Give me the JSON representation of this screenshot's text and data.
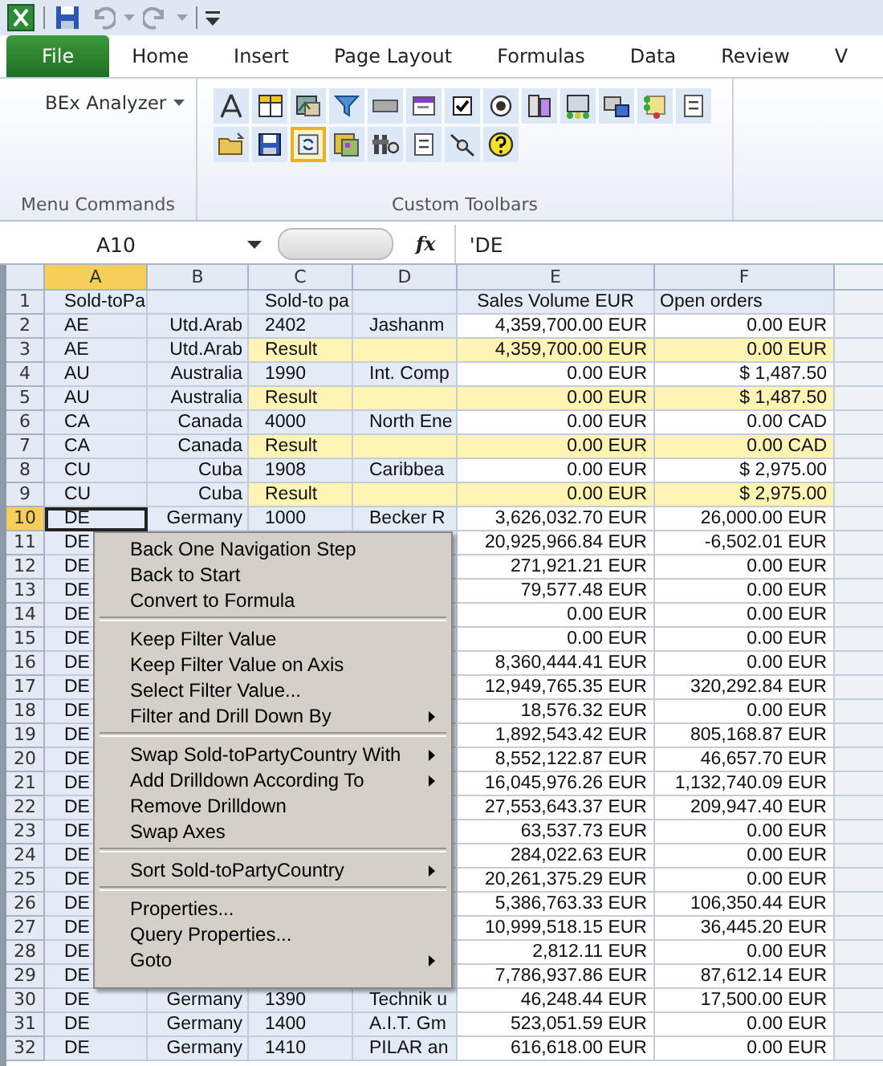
{
  "ribbon_tabs": [
    {
      "label": "File",
      "kind": "file"
    },
    {
      "label": "Home",
      "kind": "tab"
    },
    {
      "label": "Insert",
      "kind": "tab"
    },
    {
      "label": "Page Layout",
      "kind": "tab"
    },
    {
      "label": "Formulas",
      "kind": "tab"
    },
    {
      "label": "Data",
      "kind": "tab"
    },
    {
      "label": "Review",
      "kind": "tab"
    },
    {
      "label": "V",
      "kind": "tab"
    }
  ],
  "ribbon": {
    "menu_commands": {
      "button": "BEx Analyzer",
      "label": "Menu Commands"
    },
    "custom_toolbars": {
      "label": "Custom Toolbars",
      "buttons": [
        {
          "selected": false
        },
        {
          "selected": false
        },
        {
          "selected": false
        },
        {
          "selected": false
        },
        {
          "selected": false
        },
        {
          "selected": false
        },
        {
          "selected": false
        },
        {
          "selected": false
        },
        {
          "selected": false
        },
        {
          "selected": false
        },
        {
          "selected": false
        },
        {
          "selected": false
        },
        {
          "selected": false
        },
        {
          "selected": false
        },
        {
          "selected": false
        },
        {
          "selected": true
        },
        {
          "selected": false
        },
        {
          "selected": false
        },
        {
          "selected": false
        },
        {
          "selected": false
        },
        {
          "selected": false
        }
      ]
    }
  },
  "formula_bar": {
    "name_box": "A10",
    "fx": "fx",
    "value": "'DE"
  },
  "columns": [
    {
      "label": "A",
      "selected": true
    },
    {
      "label": "B",
      "selected": false
    },
    {
      "label": "C",
      "selected": false
    },
    {
      "label": "D",
      "selected": false
    },
    {
      "label": "E",
      "selected": false
    },
    {
      "label": "F",
      "selected": false
    }
  ],
  "rows": [
    {
      "num": "1",
      "kind": "header",
      "selected": false,
      "a": "Sold-toPa",
      "c": "Sold-to pa",
      "e": "Sales Volume EUR",
      "f": "Open orders"
    },
    {
      "num": "2",
      "kind": "data",
      "selected": false,
      "a": "AE",
      "b": "Utd.Arab",
      "c": "2402",
      "d": "Jashanm",
      "e": "4,359,700.00 EUR",
      "f": "0.00 EUR"
    },
    {
      "num": "3",
      "kind": "result",
      "selected": false,
      "a": "AE",
      "b": "Utd.Arab",
      "c": "Result",
      "e": "4,359,700.00 EUR",
      "f": "0.00 EUR"
    },
    {
      "num": "4",
      "kind": "data",
      "selected": false,
      "a": "AU",
      "b": "Australia",
      "c": "1990",
      "d": "Int. Comp",
      "e": "0.00 EUR",
      "f": "$ 1,487.50"
    },
    {
      "num": "5",
      "kind": "result",
      "selected": false,
      "a": "AU",
      "b": "Australia",
      "c": "Result",
      "e": "0.00 EUR",
      "f": "$ 1,487.50"
    },
    {
      "num": "6",
      "kind": "data",
      "selected": false,
      "a": "CA",
      "b": "Canada",
      "c": "4000",
      "d": "North Ene",
      "e": "0.00 EUR",
      "f": "0.00 CAD"
    },
    {
      "num": "7",
      "kind": "result",
      "selected": false,
      "a": "CA",
      "b": "Canada",
      "c": "Result",
      "e": "0.00 EUR",
      "f": "0.00 CAD"
    },
    {
      "num": "8",
      "kind": "data",
      "selected": false,
      "a": "CU",
      "b": "Cuba",
      "c": "1908",
      "d": "Caribbea",
      "e": "0.00 EUR",
      "f": "$ 2,975.00"
    },
    {
      "num": "9",
      "kind": "result",
      "selected": false,
      "a": "CU",
      "b": "Cuba",
      "c": "Result",
      "e": "0.00 EUR",
      "f": "$ 2,975.00"
    },
    {
      "num": "10",
      "kind": "data",
      "selected": true,
      "a": "DE",
      "b": "Germany",
      "c": "1000",
      "d": "Becker R",
      "e": "3,626,032.70 EUR",
      "f": "26,000.00 EUR"
    },
    {
      "num": "11",
      "kind": "data",
      "selected": false,
      "a": "DE",
      "e": "20,925,966.84 EUR",
      "f": "-6,502.01 EUR"
    },
    {
      "num": "12",
      "kind": "data",
      "selected": false,
      "a": "DE",
      "e": "271,921.21 EUR",
      "f": "0.00 EUR"
    },
    {
      "num": "13",
      "kind": "data",
      "selected": false,
      "a": "DE",
      "e": "79,577.48 EUR",
      "f": "0.00 EUR"
    },
    {
      "num": "14",
      "kind": "data",
      "selected": false,
      "a": "DE",
      "e": "0.00 EUR",
      "f": "0.00 EUR"
    },
    {
      "num": "15",
      "kind": "data",
      "selected": false,
      "a": "DE",
      "e": "0.00 EUR",
      "f": "0.00 EUR"
    },
    {
      "num": "16",
      "kind": "data",
      "selected": false,
      "a": "DE",
      "e": "8,360,444.41 EUR",
      "f": "0.00 EUR"
    },
    {
      "num": "17",
      "kind": "data",
      "selected": false,
      "a": "DE",
      "e": "12,949,765.35 EUR",
      "f": "320,292.84 EUR"
    },
    {
      "num": "18",
      "kind": "data",
      "selected": false,
      "a": "DE",
      "e": "18,576.32 EUR",
      "f": "0.00 EUR"
    },
    {
      "num": "19",
      "kind": "data",
      "selected": false,
      "a": "DE",
      "e": "1,892,543.42 EUR",
      "f": "805,168.87 EUR"
    },
    {
      "num": "20",
      "kind": "data",
      "selected": false,
      "a": "DE",
      "e": "8,552,122.87 EUR",
      "f": "46,657.70 EUR"
    },
    {
      "num": "21",
      "kind": "data",
      "selected": false,
      "a": "DE",
      "e": "16,045,976.26 EUR",
      "f": "1,132,740.09 EUR"
    },
    {
      "num": "22",
      "kind": "data",
      "selected": false,
      "a": "DE",
      "e": "27,553,643.37 EUR",
      "f": "209,947.40 EUR"
    },
    {
      "num": "23",
      "kind": "data",
      "selected": false,
      "a": "DE",
      "e": "63,537.73 EUR",
      "f": "0.00 EUR"
    },
    {
      "num": "24",
      "kind": "data",
      "selected": false,
      "a": "DE",
      "e": "284,022.63 EUR",
      "f": "0.00 EUR"
    },
    {
      "num": "25",
      "kind": "data",
      "selected": false,
      "a": "DE",
      "e": "20,261,375.29 EUR",
      "f": "0.00 EUR"
    },
    {
      "num": "26",
      "kind": "data",
      "selected": false,
      "a": "DE",
      "e": "5,386,763.33 EUR",
      "f": "106,350.44 EUR"
    },
    {
      "num": "27",
      "kind": "data",
      "selected": false,
      "a": "DE",
      "e": "10,999,518.15 EUR",
      "f": "36,445.20 EUR"
    },
    {
      "num": "28",
      "kind": "data",
      "selected": false,
      "a": "DE",
      "e": "2,812.11 EUR",
      "f": "0.00 EUR"
    },
    {
      "num": "29",
      "kind": "data",
      "selected": false,
      "a": "DE",
      "e": "7,786,937.86 EUR",
      "f": "87,612.14 EUR"
    },
    {
      "num": "30",
      "kind": "data",
      "selected": false,
      "a": "DE",
      "b": "Germany",
      "c": "1390",
      "d": "Technik u",
      "e": "46,248.44 EUR",
      "f": "17,500.00 EUR"
    },
    {
      "num": "31",
      "kind": "data",
      "selected": false,
      "a": "DE",
      "b": "Germany",
      "c": "1400",
      "d": "A.I.T. Gm",
      "e": "523,051.59 EUR",
      "f": "0.00 EUR"
    },
    {
      "num": "32",
      "kind": "data",
      "selected": false,
      "a": "DE",
      "b": "Germany",
      "c": "1410",
      "d": "PILAR an",
      "e": "616,618.00 EUR",
      "f": "0.00 EUR"
    }
  ],
  "context_menu": {
    "items": [
      {
        "kind": "item",
        "label": "Back One Navigation Step",
        "submenu": false
      },
      {
        "kind": "item",
        "label": "Back to Start",
        "submenu": false
      },
      {
        "kind": "item",
        "label": "Convert to Formula",
        "submenu": false
      },
      {
        "kind": "separator"
      },
      {
        "kind": "item",
        "label": "Keep Filter Value",
        "submenu": false
      },
      {
        "kind": "item",
        "label": "Keep Filter Value on Axis",
        "submenu": false
      },
      {
        "kind": "item",
        "label": "Select Filter Value...",
        "submenu": false
      },
      {
        "kind": "item",
        "label": "Filter and Drill Down By",
        "submenu": true
      },
      {
        "kind": "separator"
      },
      {
        "kind": "item",
        "label": "Swap Sold-toPartyCountry With",
        "submenu": true
      },
      {
        "kind": "item",
        "label": "Add Drilldown According To",
        "submenu": true
      },
      {
        "kind": "item",
        "label": "Remove Drilldown",
        "submenu": false
      },
      {
        "kind": "item",
        "label": "Swap Axes",
        "submenu": false
      },
      {
        "kind": "separator"
      },
      {
        "kind": "item",
        "label": "Sort Sold-toPartyCountry",
        "submenu": true
      },
      {
        "kind": "separator"
      },
      {
        "kind": "item",
        "label": "Properties...",
        "submenu": false
      },
      {
        "kind": "item",
        "label": "Query Properties...",
        "submenu": false
      },
      {
        "kind": "item",
        "label": "Goto",
        "submenu": true
      }
    ]
  }
}
